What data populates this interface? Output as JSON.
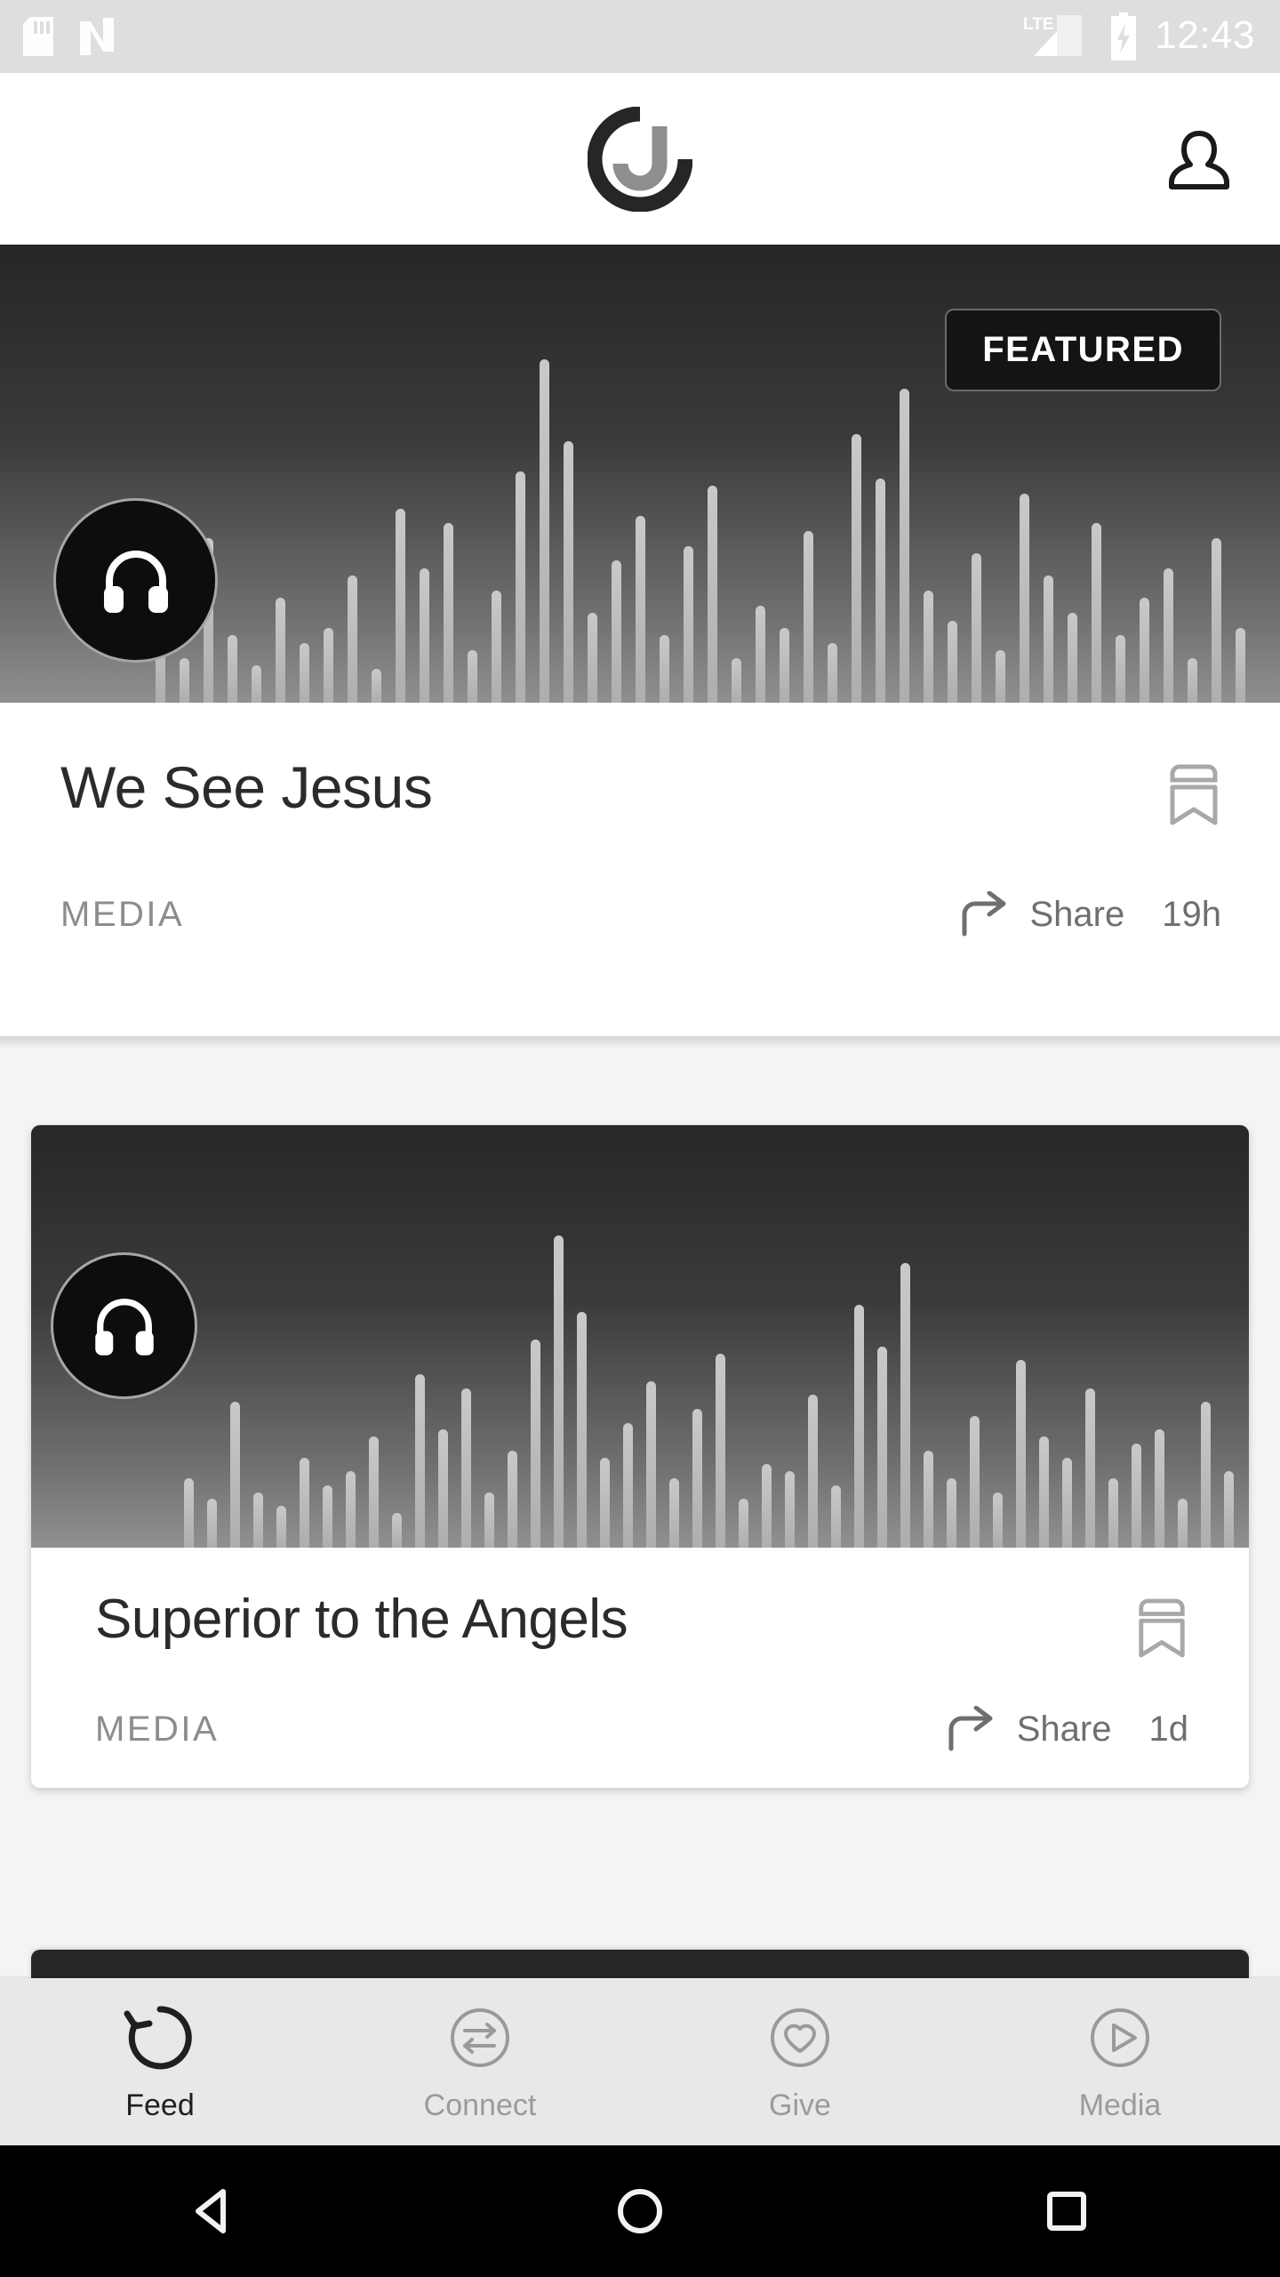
{
  "status_bar": {
    "icons": [
      "sd-card-icon",
      "nfc-icon"
    ],
    "network_label": "LTE",
    "signal_icon": "signal-bars-icon",
    "battery_icon": "battery-charging-icon",
    "time": "12:43",
    "background_color": "#dedede",
    "foreground_color": "#ffffff"
  },
  "app_bar": {
    "logo_icon": "app-logo-icon",
    "profile_icon": "person-icon"
  },
  "featured": {
    "badge_label": "FEATURED",
    "media_icon": "headphones-icon",
    "title": "We See Jesus",
    "kicker": "MEDIA",
    "bookmark_icon": "bookmark-icon",
    "share_icon": "share-arrow-icon",
    "share_label": "Share",
    "timestamp": "19h"
  },
  "feed_cards": [
    {
      "media_icon": "headphones-icon",
      "title": "Superior to the Angels",
      "kicker": "MEDIA",
      "bookmark_icon": "bookmark-icon",
      "share_icon": "share-arrow-icon",
      "share_label": "Share",
      "timestamp": "1d"
    }
  ],
  "tabs": [
    {
      "label": "Feed",
      "icon": "refresh-circle-icon",
      "active": true
    },
    {
      "label": "Connect",
      "icon": "exchange-arrows-circle-icon",
      "active": false
    },
    {
      "label": "Give",
      "icon": "heart-circle-icon",
      "active": false
    },
    {
      "label": "Media",
      "icon": "play-circle-icon",
      "active": false
    }
  ],
  "android_nav": {
    "back_icon": "back-triangle-icon",
    "home_icon": "home-circle-icon",
    "recents_icon": "recents-square-icon"
  },
  "colors": {
    "feed_background": "#f4f4f4",
    "card_background": "#ffffff",
    "hero_dark": "#262626",
    "hero_light": "#909090",
    "muted_text": "#8d8d8d",
    "tabbar_background": "#e8e8e8"
  },
  "waveform": {
    "featured": [
      22,
      12,
      44,
      18,
      10,
      28,
      16,
      20,
      34,
      9,
      52,
      36,
      48,
      14,
      30,
      62,
      92,
      70,
      24,
      38,
      50,
      18,
      42,
      58,
      12,
      26,
      20,
      46,
      16,
      72,
      60,
      84,
      30,
      22,
      40,
      14,
      56,
      34,
      24,
      48,
      18,
      28,
      36,
      12,
      44,
      20
    ],
    "card": [
      20,
      14,
      42,
      16,
      12,
      26,
      18,
      22,
      32,
      10,
      50,
      34,
      46,
      16,
      28,
      60,
      90,
      68,
      26,
      36,
      48,
      20,
      40,
      56,
      14,
      24,
      22,
      44,
      18,
      70,
      58,
      82,
      28,
      20,
      38,
      16,
      54,
      32,
      26,
      46,
      20,
      30,
      34,
      14,
      42,
      22
    ]
  }
}
